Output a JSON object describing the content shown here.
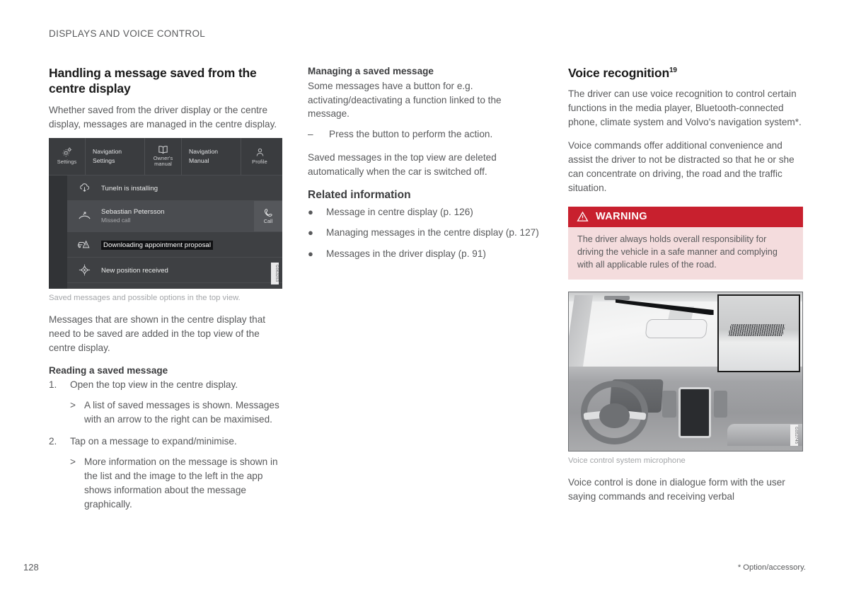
{
  "header": {
    "running_title": "DISPLAYS AND VOICE CONTROL"
  },
  "footer": {
    "page_number": "128",
    "footnote": "* Option/accessory."
  },
  "left_column": {
    "title": "Handling a message saved from the centre display",
    "intro": "Whether saved from the driver display or the centre display, messages are managed in the centre display.",
    "figure": {
      "caption": "Saved messages and possible options in the top view.",
      "image_id": "G063253",
      "centre_display": {
        "top_bar": [
          {
            "type": "icon",
            "icon": "settings-gear-icon",
            "label": "Settings"
          },
          {
            "type": "text",
            "label": "Navigation Settings"
          },
          {
            "type": "icon",
            "icon": "owners-manual-book-icon",
            "label": "Owner's manual"
          },
          {
            "type": "text",
            "label": "Navigation Manual"
          },
          {
            "type": "icon",
            "icon": "profile-person-icon",
            "label": "Profile"
          }
        ],
        "messages": [
          {
            "icon": "cloud-download-icon",
            "title": "TuneIn is installing",
            "subtitle": "",
            "highlighted": false,
            "inverted": false,
            "action": ""
          },
          {
            "icon": "missed-call-icon",
            "title": "Sebastian Petersson",
            "subtitle": "Missed call",
            "highlighted": true,
            "inverted": false,
            "action": "Call"
          },
          {
            "icon": "car-warning-icon",
            "title": "Downloading appointment proposal",
            "subtitle": "",
            "highlighted": false,
            "inverted": true,
            "action": ""
          },
          {
            "icon": "compass-position-icon",
            "title": "New position received",
            "subtitle": "",
            "highlighted": false,
            "inverted": false,
            "action": ""
          }
        ]
      }
    },
    "after_figure": "Messages that are shown in the centre display that need to be saved are added in the top view of the centre display.",
    "reading_heading": "Reading a saved message",
    "steps": [
      {
        "number": "1.",
        "text": "Open the top view in the centre display.",
        "sub_mark": ">",
        "sub_text": "A list of saved messages is shown. Messages with an arrow to the right can be maximised."
      },
      {
        "number": "2.",
        "text": "Tap on a message to expand/minimise.",
        "sub_mark": ">",
        "sub_text": "More information on the message is shown in the list and the image to the left in the app shows information about the message graphically."
      }
    ]
  },
  "middle_column": {
    "managing_heading": "Managing a saved message",
    "managing_intro": "Some messages have a button for e.g. activating/deactivating a function linked to the message.",
    "dash_mark": "–",
    "dash_item": "Press the button to perform the action.",
    "managing_outro": "Saved messages in the top view are deleted automatically when the car is switched off.",
    "related_heading": "Related information",
    "bullet_mark": "●",
    "related_links": [
      "Message in centre display (p. 126)",
      "Managing messages in the centre display (p. 127)",
      "Messages in the driver display (p. 91)"
    ]
  },
  "right_column": {
    "title": "Voice recognition",
    "title_superscript": "19",
    "paragraph_1": "The driver can use voice recognition to control certain functions in the media player, Bluetooth-connected phone, climate system and Volvo's navigation system*.",
    "paragraph_2": "Voice commands offer additional convenience and assist the driver to not be distracted so that he or she can concentrate on driving, the road and the traffic situation.",
    "warning": {
      "icon": "warning-triangle-icon",
      "title": "WARNING",
      "body": "The driver always holds overall responsibility for driving the vehicle in a safe manner and complying with all applicable rules of the road.",
      "header_color": "#c8202e",
      "body_color": "#f4dcdd"
    },
    "photo": {
      "caption": "Voice control system microphone",
      "image_id": "G052745"
    },
    "paragraph_3": "Voice control is done in dialogue form with the user saying commands and receiving verbal"
  }
}
